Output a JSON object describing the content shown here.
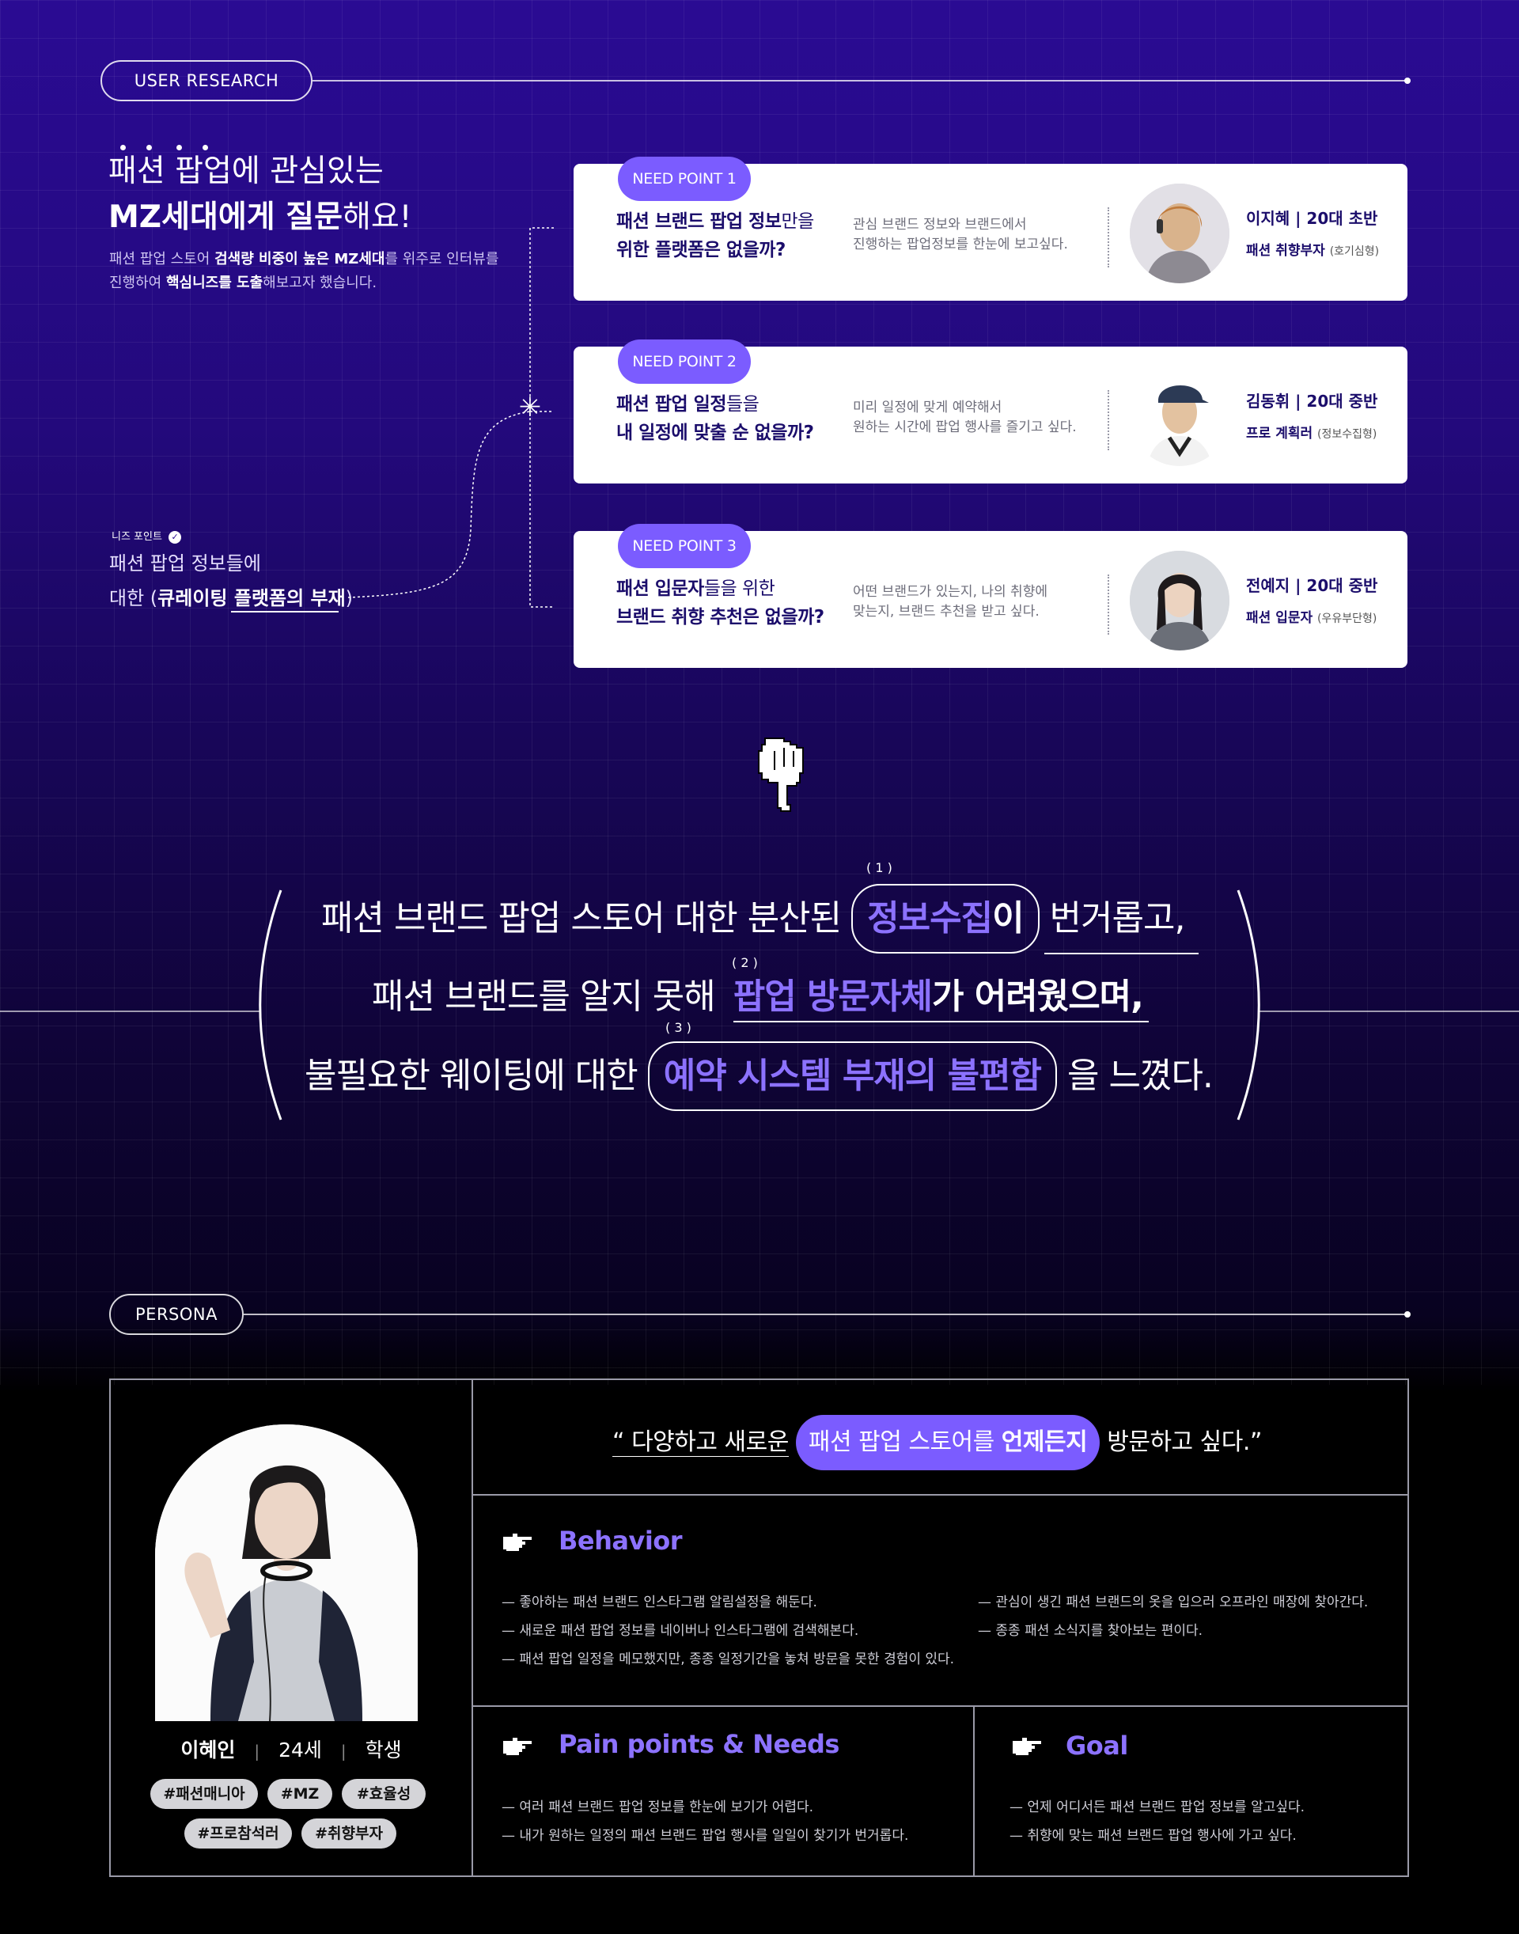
{
  "research": {
    "label": "USER RESEARCH",
    "intro_title_1_a": "패션 팝업",
    "intro_title_1_b": "에 관심있는",
    "intro_title_2_a": "MZ세대에게 질문",
    "intro_title_2_b": "해요!",
    "intro_desc_1_a": "패션 팝업 스토어 ",
    "intro_desc_1_b": "검색량 비중이 높은 MZ세대",
    "intro_desc_1_c": "를 위주로 인터뷰를",
    "intro_desc_2_a": "진행하여 ",
    "intro_desc_2_b": "핵심니즈를 도출",
    "intro_desc_2_c": "해보고자 했습니다.",
    "needs_point_label": "니즈 포인트",
    "needs_point_line1": "패션 팝업 정보들에",
    "needs_point_line2_a": "대한 (",
    "needs_point_line2_b": "큐레이팅 플랫폼의 부재",
    "needs_point_line2_c": ")"
  },
  "need_points": [
    {
      "tag": "NEED POINT 1",
      "q_line1_bold": "패션 브랜드 팝업 정보",
      "q_line1_light": "만을",
      "q_line2": "위한 플랫폼은 없을까?",
      "desc_line1": "관심 브랜드 정보와 브랜드에서",
      "desc_line2": "진행하는 팝업정보를 한눈에 보고싶다.",
      "name": "이지혜 | 20대 초반",
      "type": "패션 취향부자",
      "type_sub": "(호기심형)"
    },
    {
      "tag": "NEED POINT 2",
      "q_line1_bold": "패션 팝업 일정",
      "q_line1_light": "들을",
      "q_line2": "내 일정에 맞출 순 없을까?",
      "desc_line1": "미리 일정에 맞게 예약해서",
      "desc_line2": "원하는 시간에 팝업 행사를 즐기고 싶다.",
      "name": "김동휘 | 20대 중반",
      "type": "프로 계획러",
      "type_sub": "(정보수집형)"
    },
    {
      "tag": "NEED POINT 3",
      "q_line1_bold": "패션 입문자",
      "q_line1_light": "들을 위한",
      "q_line2": "브랜드 취향 추천은 없을까?",
      "desc_line1": "어떤 브랜드가 있는지, 나의 취향에",
      "desc_line2": "맞는지, 브랜드 추천을 받고 싶다.",
      "name": "전예지 | 20대 중반",
      "type": "패션 입문자",
      "type_sub": "(우유부단형)"
    }
  ],
  "insight": {
    "line1_a": "패션 브랜드 팝업 스토어 대한 분산된",
    "line1_hl_a": "정보수집",
    "line1_hl_b": "이",
    "line1_b": "번거롭고,",
    "line2_a": "패션 브랜드를 알지 못해",
    "line2_hl_a": "팝업 방문자체",
    "line2_hl_b": "가 어려웠으며,",
    "line3_a": "불필요한 웨이팅에 대한",
    "line3_hl": "예약 시스템 부재의 불편함",
    "line3_b": "을 느꼈다.",
    "num1": "( 1 )",
    "num2": "( 2 )",
    "num3": "( 3 )"
  },
  "persona": {
    "label": "PERSONA",
    "name": "이혜인",
    "age": "24세",
    "job": "학생",
    "sep": "|",
    "tags": [
      "#패션매니아",
      "#MZ",
      "#효율성",
      "#프로참석러",
      "#취향부자"
    ],
    "quote_open": "“ 다양하고 새로운",
    "quote_hl_a": "패션 팝업 스토어를 ",
    "quote_hl_b": "언제든지",
    "quote_close": "방문하고 싶다.”",
    "behavior_title": "Behavior",
    "behavior_left": [
      "좋아하는 패션 브랜드 인스타그램 알림설정을 해둔다.",
      "새로운 패션 팝업 정보를 네이버나 인스타그램에 검색해본다.",
      "패션 팝업 일정을 메모했지만, 종종 일정기간을 놓쳐 방문을 못한 경험이 있다."
    ],
    "behavior_right": [
      "관심이 생긴 패션 브랜드의 옷을 입으러 오프라인 매장에 찾아간다.",
      "종종 패션 소식지를  찾아보는 편이다."
    ],
    "pain_title": "Pain points & Needs",
    "pain_items": [
      "여러 패션 브랜드 팝업 정보를 한눈에 보기가 어렵다.",
      "내가 원하는 일정의 패션 브랜드 팝업 행사를 일일이 찾기가 번거롭다."
    ],
    "goal_title": "Goal",
    "goal_items": [
      "언제 어디서든 패션 브랜드 팝업 정보를 알고싶다.",
      "취향에 맞는 패션 브랜드 팝업 행사에 가고 싶다."
    ]
  },
  "colors": {
    "accent": "#7b5cff",
    "accent_text": "#8c72ff",
    "navy": "#1b0d6b",
    "bg_top": "#2a0b93",
    "bg_bottom": "#000000"
  },
  "icons": [
    "asterisk-icon",
    "pointing-hand-icon",
    "check-circle-icon",
    "hand-right-icon"
  ]
}
